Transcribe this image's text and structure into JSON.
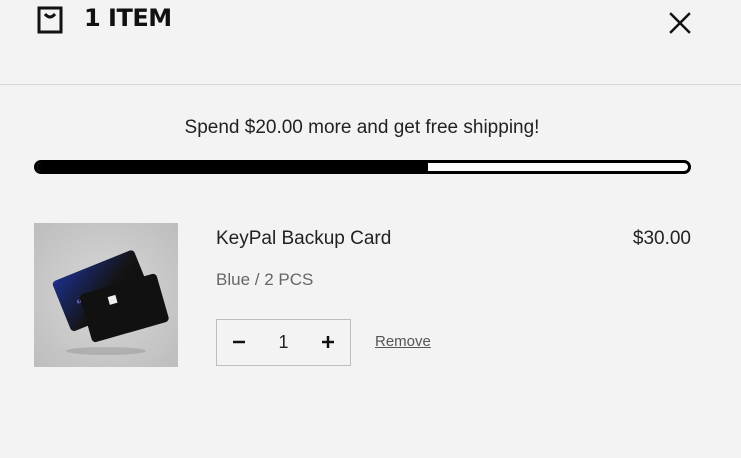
{
  "cart": {
    "title": "1 ITEM",
    "icons": {
      "bag": "shopping-bag-icon",
      "close": "close-icon"
    }
  },
  "shipping": {
    "message": "Spend $20.00 more and get free shipping!",
    "progress": 0.6
  },
  "items": [
    {
      "name": "KeyPal Backup Card",
      "variant": "Blue / 2 PCS",
      "price": "$30.00",
      "quantity": "1",
      "remove_label": "Remove",
      "decrease_icon": "minus-icon",
      "increase_icon": "plus-icon"
    }
  ],
  "colors": {
    "background": "#f3f3f3",
    "progress": "#000000",
    "text": "#222222"
  }
}
